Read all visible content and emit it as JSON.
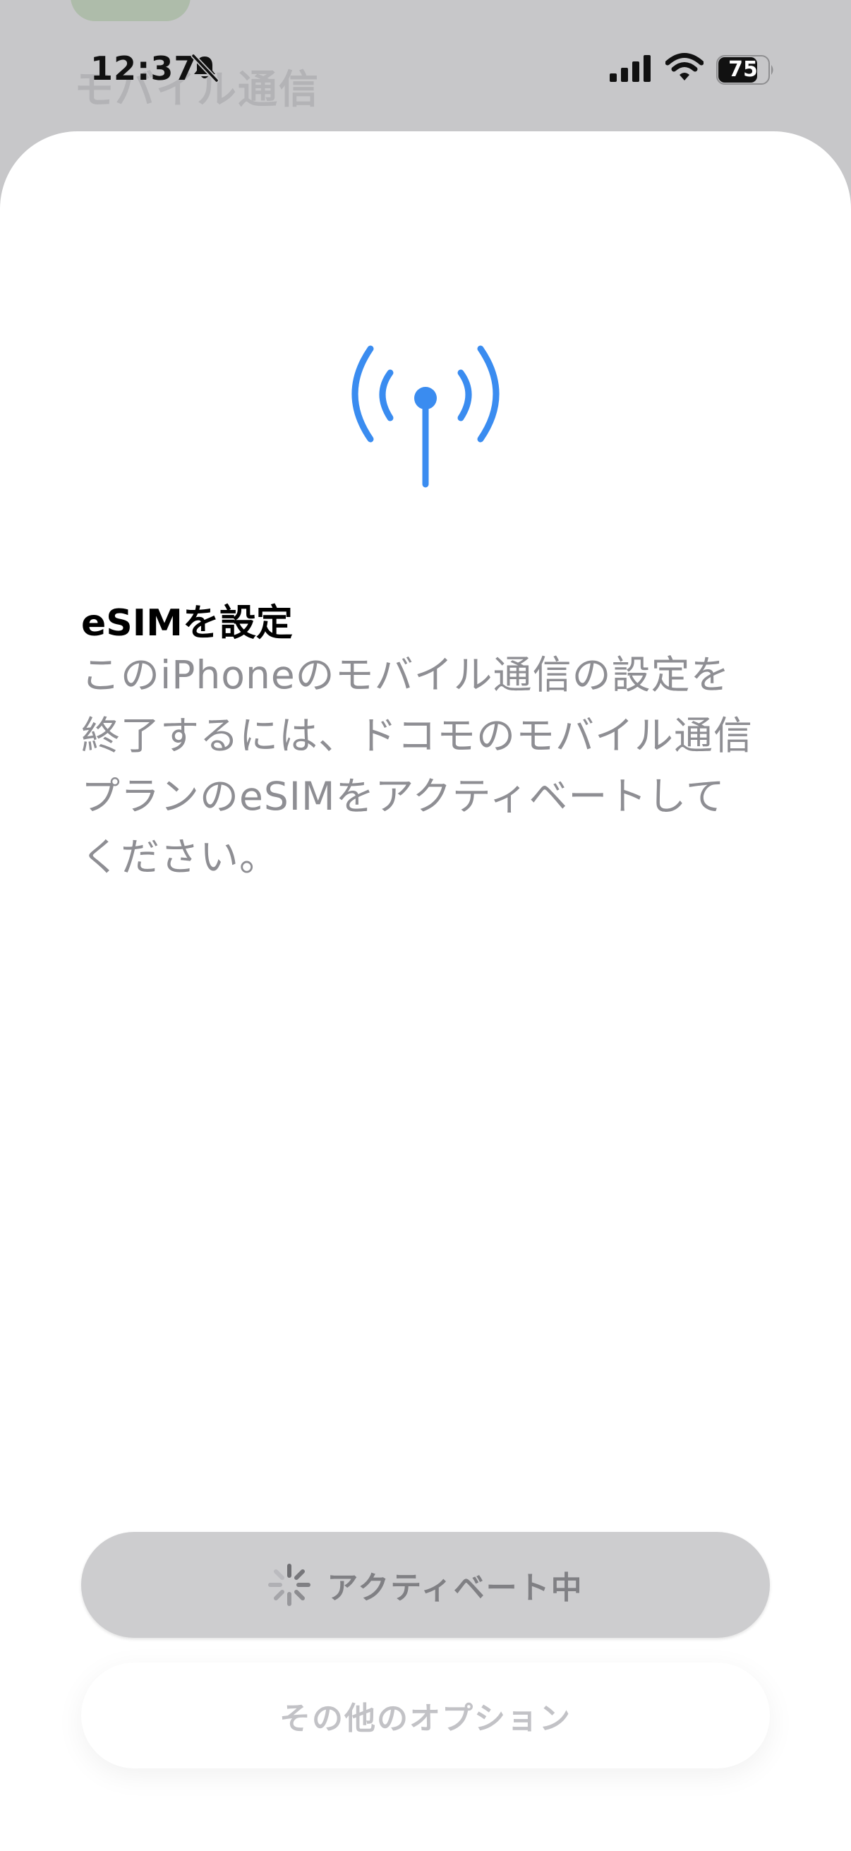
{
  "background": {
    "title": "モバイル通信"
  },
  "status_bar": {
    "time": "12:37",
    "battery": "75",
    "icons": [
      "bell-slash-icon",
      "cellular-signal-icon",
      "wifi-icon",
      "battery-icon"
    ]
  },
  "sheet": {
    "icon": "antenna-radiowaves-icon",
    "icon_color": "#3a8cf0",
    "heading": "eSIMを設定",
    "description": "このiPhoneのモバイル通信の設定を終了するには、ドコモのモバイル通信プランのeSIMをアクティベートしてください。",
    "primary_button": {
      "label": "アクティベート中",
      "icon": "spinner-icon"
    },
    "secondary_button": {
      "label": "その他のオプション"
    }
  }
}
